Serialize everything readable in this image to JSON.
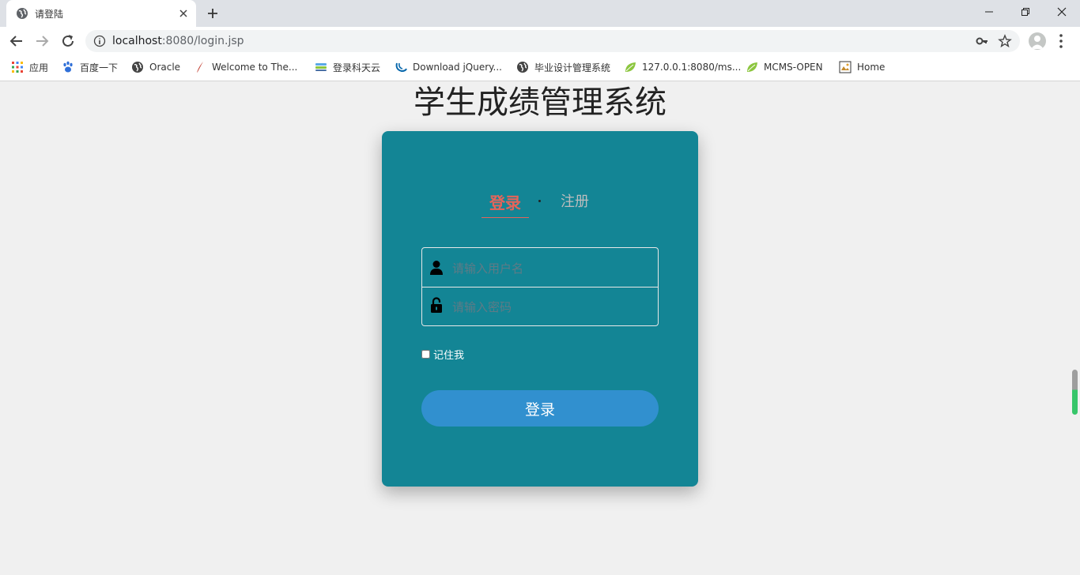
{
  "browser": {
    "tab_title": "请登陆",
    "url_host": "localhost",
    "url_rest": ":8080/login.jsp",
    "bookmarks": [
      {
        "label": "应用",
        "icon": "apps-grid-icon"
      },
      {
        "label": "百度一下",
        "icon": "baidu-paw-icon"
      },
      {
        "label": "Oracle",
        "icon": "globe-icon"
      },
      {
        "label": "Welcome to The...",
        "icon": "feather-icon"
      },
      {
        "label": "登录科天云",
        "icon": "layers-icon"
      },
      {
        "label": "Download jQuery...",
        "icon": "jquery-icon"
      },
      {
        "label": "毕业设计管理系统",
        "icon": "globe-icon"
      },
      {
        "label": "127.0.0.1:8080/ms...",
        "icon": "spring-leaf-icon"
      },
      {
        "label": "MCMS-OPEN",
        "icon": "spring-leaf-icon"
      },
      {
        "label": "Home",
        "icon": "image-icon"
      }
    ]
  },
  "page": {
    "title": "学生成绩管理系统",
    "tabs": {
      "login": "登录",
      "register": "注册"
    },
    "username_placeholder": "请输入用户名",
    "password_placeholder": "请输入密码",
    "remember_label": "记住我",
    "remember_checked": false,
    "submit_label": "登录"
  },
  "colors": {
    "card": "#138595",
    "active_tab": "#e5645a",
    "button": "#3190cf",
    "page_bg": "#f0f0f0"
  }
}
